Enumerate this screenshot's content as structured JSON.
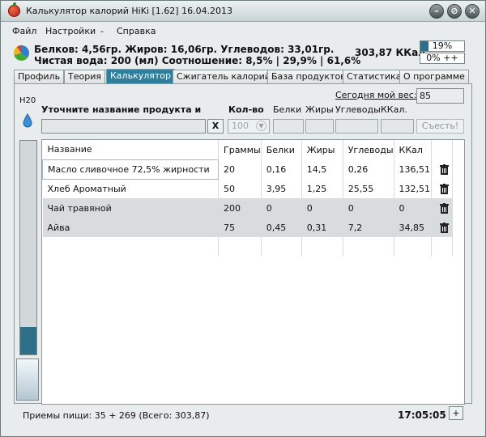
{
  "window": {
    "title": "Калькулятор калорий HiKi [1.62] 16.04.2013",
    "minimize_icon": "minimize-icon",
    "restore_icon": "restore-icon",
    "close_icon": "close-icon"
  },
  "menu": [
    "Файл",
    "Настройки",
    "-",
    "Справка"
  ],
  "summary": {
    "line1": "Белков: 4,56гр. Жиров: 16,06гр. Углеводов: 33,01гр.",
    "line2": "Чистая вода: 200 (мл) Соотношение: 8,5% | 29,9% | 61,6%",
    "kcal_total": "303,87 ККал",
    "progress_top": {
      "label": "19%",
      "value": 0.19
    },
    "progress_bottom": {
      "label": "0% ++",
      "value": 0
    }
  },
  "tabs": [
    "Профиль",
    "Теория",
    "Калькулятор",
    "Сжигатель калорий",
    "База продуктов",
    "Статистика",
    "О программе"
  ],
  "active_tab": 2,
  "calculator": {
    "h2o_label": "H20",
    "water_level": 0.13,
    "weight_label": "Сегодня мой вес:",
    "weight_value": "85",
    "product_label": "Уточните название продукта и",
    "qty_label": "Кол-во",
    "proteins_label": "Белки",
    "fats_label": "Жиры",
    "carbs_label": "Углеводы",
    "kcal_label": "ККал.",
    "clear_label": "X",
    "qty_value": "100",
    "eat_label": "Съесть!"
  },
  "table": {
    "columns": [
      "Название",
      "Граммы",
      "Белки",
      "Жиры",
      "Углеводы",
      "ККал"
    ],
    "rows": [
      [
        "Масло сливочное 72,5% жирности",
        "20",
        "0,16",
        "14,5",
        "0,26",
        "136,51"
      ],
      [
        "Хлеб Ароматный",
        "50",
        "3,95",
        "1,25",
        "25,55",
        "132,51"
      ],
      [
        "Чай травяной",
        "200",
        "0",
        "0",
        "0",
        "0"
      ],
      [
        "Айва",
        "75",
        "0,45",
        "0,31",
        "7,2",
        "34,85"
      ]
    ]
  },
  "status": {
    "meals": "Приемы пищи:  35 + 269 (Всего: 303,87)",
    "clock": "17:05:05",
    "plus_label": "+"
  },
  "colors": {
    "accent": "#2f7f9c",
    "fill": "#2e6f8a"
  }
}
